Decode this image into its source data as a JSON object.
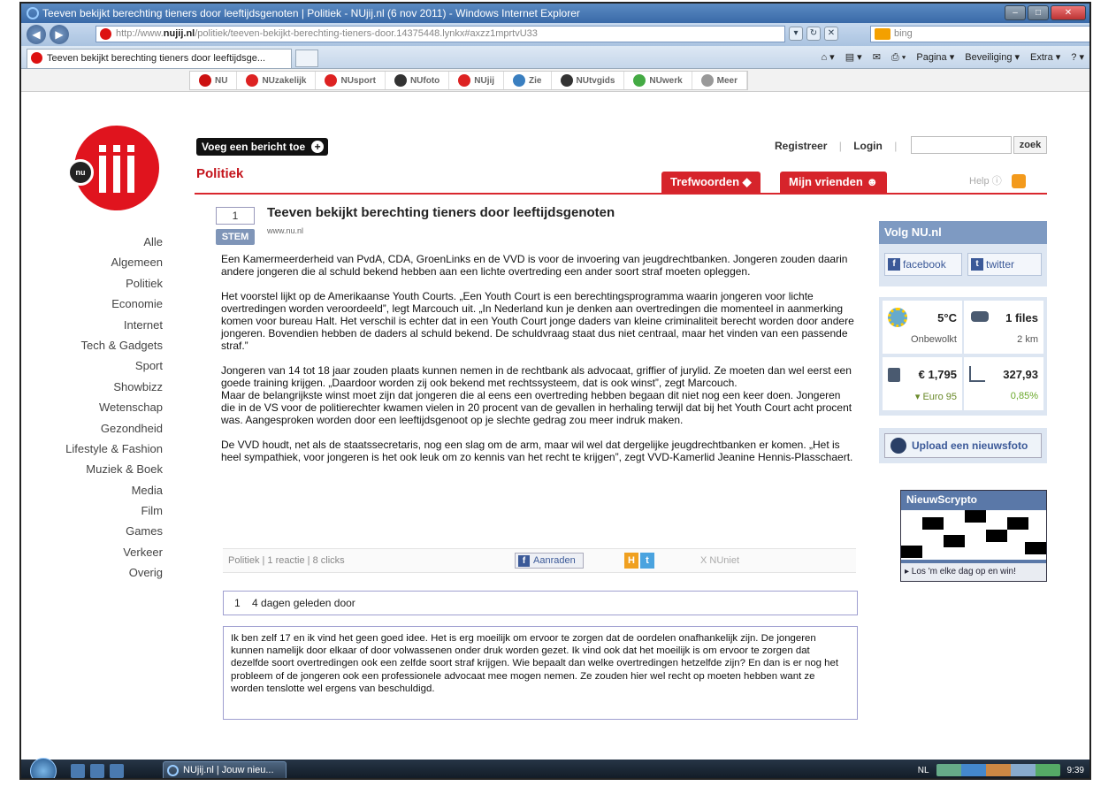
{
  "window": {
    "title": "Teeven bekijkt berechting tieners door leeftijdsgenoten | Politiek - NUjij.nl (6 nov 2011) - Windows Internet Explorer",
    "url_prefix": "http://www.",
    "url_domain": "nujij.nl",
    "url_rest": "/politiek/teeven-bekijkt-berechting-tieners-door.14375448.lynkx#axzz1mprtvU33",
    "search_placeholder": "bing",
    "tab_title": "Teeven bekijkt berechting tieners door leeftijdsge...",
    "cmd_pagina": "Pagina ▾",
    "cmd_beveiliging": "Beveiliging ▾",
    "cmd_extra": "Extra ▾"
  },
  "nustrip": [
    {
      "label": "NU",
      "color": "#c11"
    },
    {
      "label": "NUzakelijk",
      "color": "#d22"
    },
    {
      "label": "NUsport",
      "color": "#d22"
    },
    {
      "label": "NUfoto",
      "color": "#333"
    },
    {
      "label": "NUjij",
      "color": "#d22"
    },
    {
      "label": "Zie",
      "color": "#3a7fc0"
    },
    {
      "label": "NUtvgids",
      "color": "#333"
    },
    {
      "label": "NUwerk",
      "color": "#4a4"
    },
    {
      "label": "Meer",
      "color": "#999"
    }
  ],
  "header": {
    "voeg": "Voeg een bericht toe",
    "registreer": "Registreer",
    "login": "Login",
    "zoek": "zoek",
    "section": "Politiek",
    "trefwoorden": "Trefwoorden",
    "vrienden": "Mijn vrienden",
    "help": "Help"
  },
  "leftnav": [
    "Alle",
    "Algemeen",
    "Politiek",
    "Economie",
    "Internet",
    "Tech & Gadgets",
    "Sport",
    "Showbizz",
    "Wetenschap",
    "Gezondheid",
    "Lifestyle & Fashion",
    "Muziek & Boek",
    "Media",
    "Film",
    "Games",
    "Verkeer",
    "Overig"
  ],
  "article": {
    "votes": "1",
    "stem": "STEM",
    "title": "Teeven bekijkt berechting tieners door leeftijdsgenoten",
    "source": "www.nu.nl",
    "p1": "Een Kamermeerderheid van PvdA, CDA, GroenLinks en de VVD is voor de invoering van jeugdrechtbanken. Jongeren zouden daarin andere jongeren die al schuld bekend hebben aan een lichte overtreding een ander soort straf moeten opleggen.",
    "p2": "Het voorstel lijkt op de Amerikaanse Youth Courts. „Een Youth Court is een berechtingsprogramma waarin jongeren voor lichte overtredingen worden veroordeeld”, legt Marcouch uit. „In Nederland kun je denken aan overtredingen die momenteel in aanmerking komen voor bureau Halt. Het verschil is echter dat in een Youth Court jonge daders van kleine criminaliteit berecht worden door andere jongeren. Bovendien hebben de daders al schuld bekend. De schuldvraag staat dus niet centraal, maar het vinden van een passende straf.”",
    "p3": "Jongeren van 14 tot 18 jaar zouden plaats kunnen nemen in de rechtbank als advocaat, griffier of jurylid. Ze moeten dan wel eerst een goede training krijgen. „Daardoor worden zij ook bekend met rechtssysteem, dat is ook winst”, zegt Marcouch.",
    "p4": "Maar de belangrijkste winst moet zijn dat jongeren die al eens een overtreding hebben begaan dit niet nog een keer doen. Jongeren die in de VS voor de politierechter kwamen vielen in 20 procent van de gevallen in herhaling terwijl dat bij het Youth Court acht procent was. Aangesproken worden door een leeftijdsgenoot op je slechte gedrag zou meer indruk maken.",
    "p5": "De VVD houdt, net als de staatssecretaris, nog een slag om de arm, maar wil wel dat dergelijke jeugdrechtbanken er komen. „Het is heel sympathiek, voor jongeren is het ook leuk om zo kennis van het recht te krijgen”, zegt VVD-Kamerlid Jeanine Hennis-Plasschaert."
  },
  "meta": {
    "text": "Politiek | 1 reactie | 8 clicks",
    "aanraden": "Aanraden",
    "hyves": "H",
    "twitter": "t",
    "nuniet": "X NUniet"
  },
  "reaction": {
    "header": "1    4 dagen geleden door",
    "body": "Ik ben zelf 17 en ik vind het geen goed idee. Het is erg moeilijk om ervoor te zorgen dat de oordelen onafhankelijk zijn. De jongeren kunnen namelijk door elkaar of door volwassenen onder druk worden gezet. Ik vind ook dat het moeilijk is om ervoor te zorgen dat dezelfde soort overtredingen ook een zelfde soort straf krijgen. Wie bepaalt dan welke overtredingen hetzelfde zijn? En dan is er nog het probleem of de jongeren ook een professionele advocaat mee mogen nemen. Ze zouden hier wel recht op moeten hebben want ze worden tenslotte wel ergens van beschuldigd."
  },
  "sidebar": {
    "volg": "Volg NU.nl",
    "facebook": "facebook",
    "twitter": "twitter",
    "temp": "5°C",
    "weather": "Onbewolkt",
    "files": "1 files",
    "files_km": "2 km",
    "fuel_price": "€ 1,795",
    "fuel_type": "▾ Euro 95",
    "index_value": "327,93",
    "index_change": "0,85%",
    "upload": "Upload een nieuwsfoto",
    "crypto_title": "NieuwScrypto",
    "crypto_sub": "▸ Los 'm elke dag op en win!"
  },
  "taskbar": {
    "task": "NUjij.nl | Jouw nieu...",
    "lang": "NL",
    "time": "9:39"
  }
}
